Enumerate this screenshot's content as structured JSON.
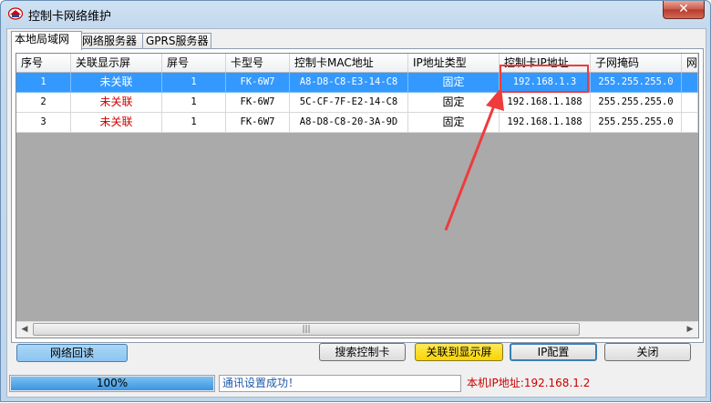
{
  "window": {
    "title": "控制卡网络维护",
    "close_label": "✕"
  },
  "tabs": [
    {
      "label": "本地局域网",
      "active": true
    },
    {
      "label": "网络服务器",
      "active": false
    },
    {
      "label": "GPRS服务器",
      "active": false
    }
  ],
  "table": {
    "columns": [
      "序号",
      "关联显示屏",
      "屏号",
      "卡型号",
      "控制卡MAC地址",
      "IP地址类型",
      "控制卡IP地址",
      "子网掩码",
      "网"
    ],
    "rows": [
      {
        "index": "1",
        "link": "未关联",
        "screen": "1",
        "model": "FK-6W7",
        "mac": "A8-D8-C8-E3-14-C8",
        "ip_type": "固定",
        "ip": "192.168.1.3",
        "mask": "255.255.255.0",
        "selected": true
      },
      {
        "index": "2",
        "link": "未关联",
        "screen": "1",
        "model": "FK-6W7",
        "mac": "5C-CF-7F-E2-14-C8",
        "ip_type": "固定",
        "ip": "192.168.1.188",
        "mask": "255.255.255.0",
        "selected": false
      },
      {
        "index": "3",
        "link": "未关联",
        "screen": "1",
        "model": "FK-6W7",
        "mac": "A8-D8-C8-20-3A-9D",
        "ip_type": "固定",
        "ip": "192.168.1.188",
        "mask": "255.255.255.0",
        "selected": false
      }
    ],
    "scroll_grip": "|||"
  },
  "buttons": {
    "network_read": "网络回读",
    "search_card": "搜索控制卡",
    "link_screen": "关联到显示屏",
    "ip_config": "IP配置",
    "close": "关闭"
  },
  "status": {
    "progress_fraction": 1.0,
    "progress_text": "100%",
    "message": "通讯设置成功！",
    "local_ip": "本机IP地址:192.168.1.2"
  },
  "colors": {
    "selected_row": "#3399ff",
    "link_red": "#d00000",
    "annotation_red": "#ef3b3b"
  }
}
